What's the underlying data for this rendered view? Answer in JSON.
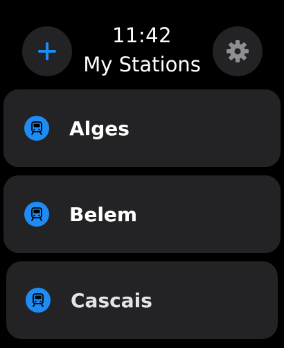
{
  "header": {
    "time": "11:42",
    "title": "My Stations",
    "add_icon": "plus-icon",
    "settings_icon": "gear-icon"
  },
  "stations": [
    {
      "name": "Alges",
      "icon": "train-icon"
    },
    {
      "name": "Belem",
      "icon": "train-icon"
    },
    {
      "name": "Cascais",
      "icon": "train-icon"
    }
  ],
  "colors": {
    "accent": "#1e8cf4",
    "card": "#232325",
    "background": "#000000",
    "gear": "#8e8e93"
  }
}
